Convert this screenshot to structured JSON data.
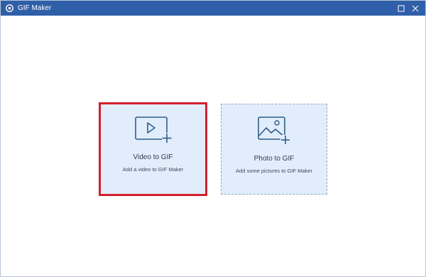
{
  "window": {
    "title": "GIF Maker",
    "title_bar_color": "#2f5fa8",
    "icons": {
      "app": "gif-maker-logo-icon",
      "maximize": "maximize-icon",
      "close": "close-icon"
    }
  },
  "cards": {
    "video": {
      "title": "Video to GIF",
      "subtitle": "Add a video to GIF Maker",
      "icon": "video-add-icon",
      "highlight_color": "#d41f2c"
    },
    "photo": {
      "title": "Photo to GIF",
      "subtitle": "Add some pictures to GIF Maker",
      "icon": "image-add-icon"
    }
  }
}
